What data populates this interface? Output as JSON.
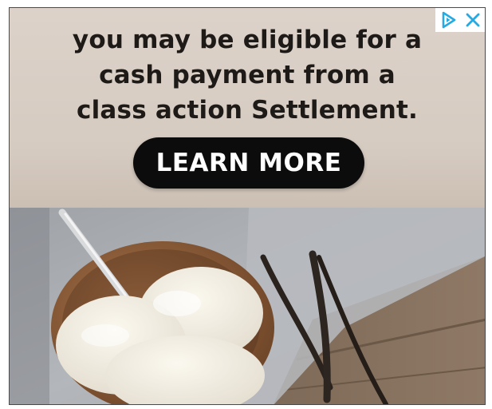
{
  "ad": {
    "headline_lines": [
      "you may be eligible for a",
      "cash payment from a",
      "class action Settlement."
    ],
    "cta_label": "LEARN MORE"
  },
  "ad_controls": {
    "adchoices_icon": "adchoices-play-icon",
    "close_icon": "close-x-icon",
    "accent_color": "#27aae1"
  },
  "image": {
    "subject": "vanilla-ice-cream-bowl-photo"
  }
}
